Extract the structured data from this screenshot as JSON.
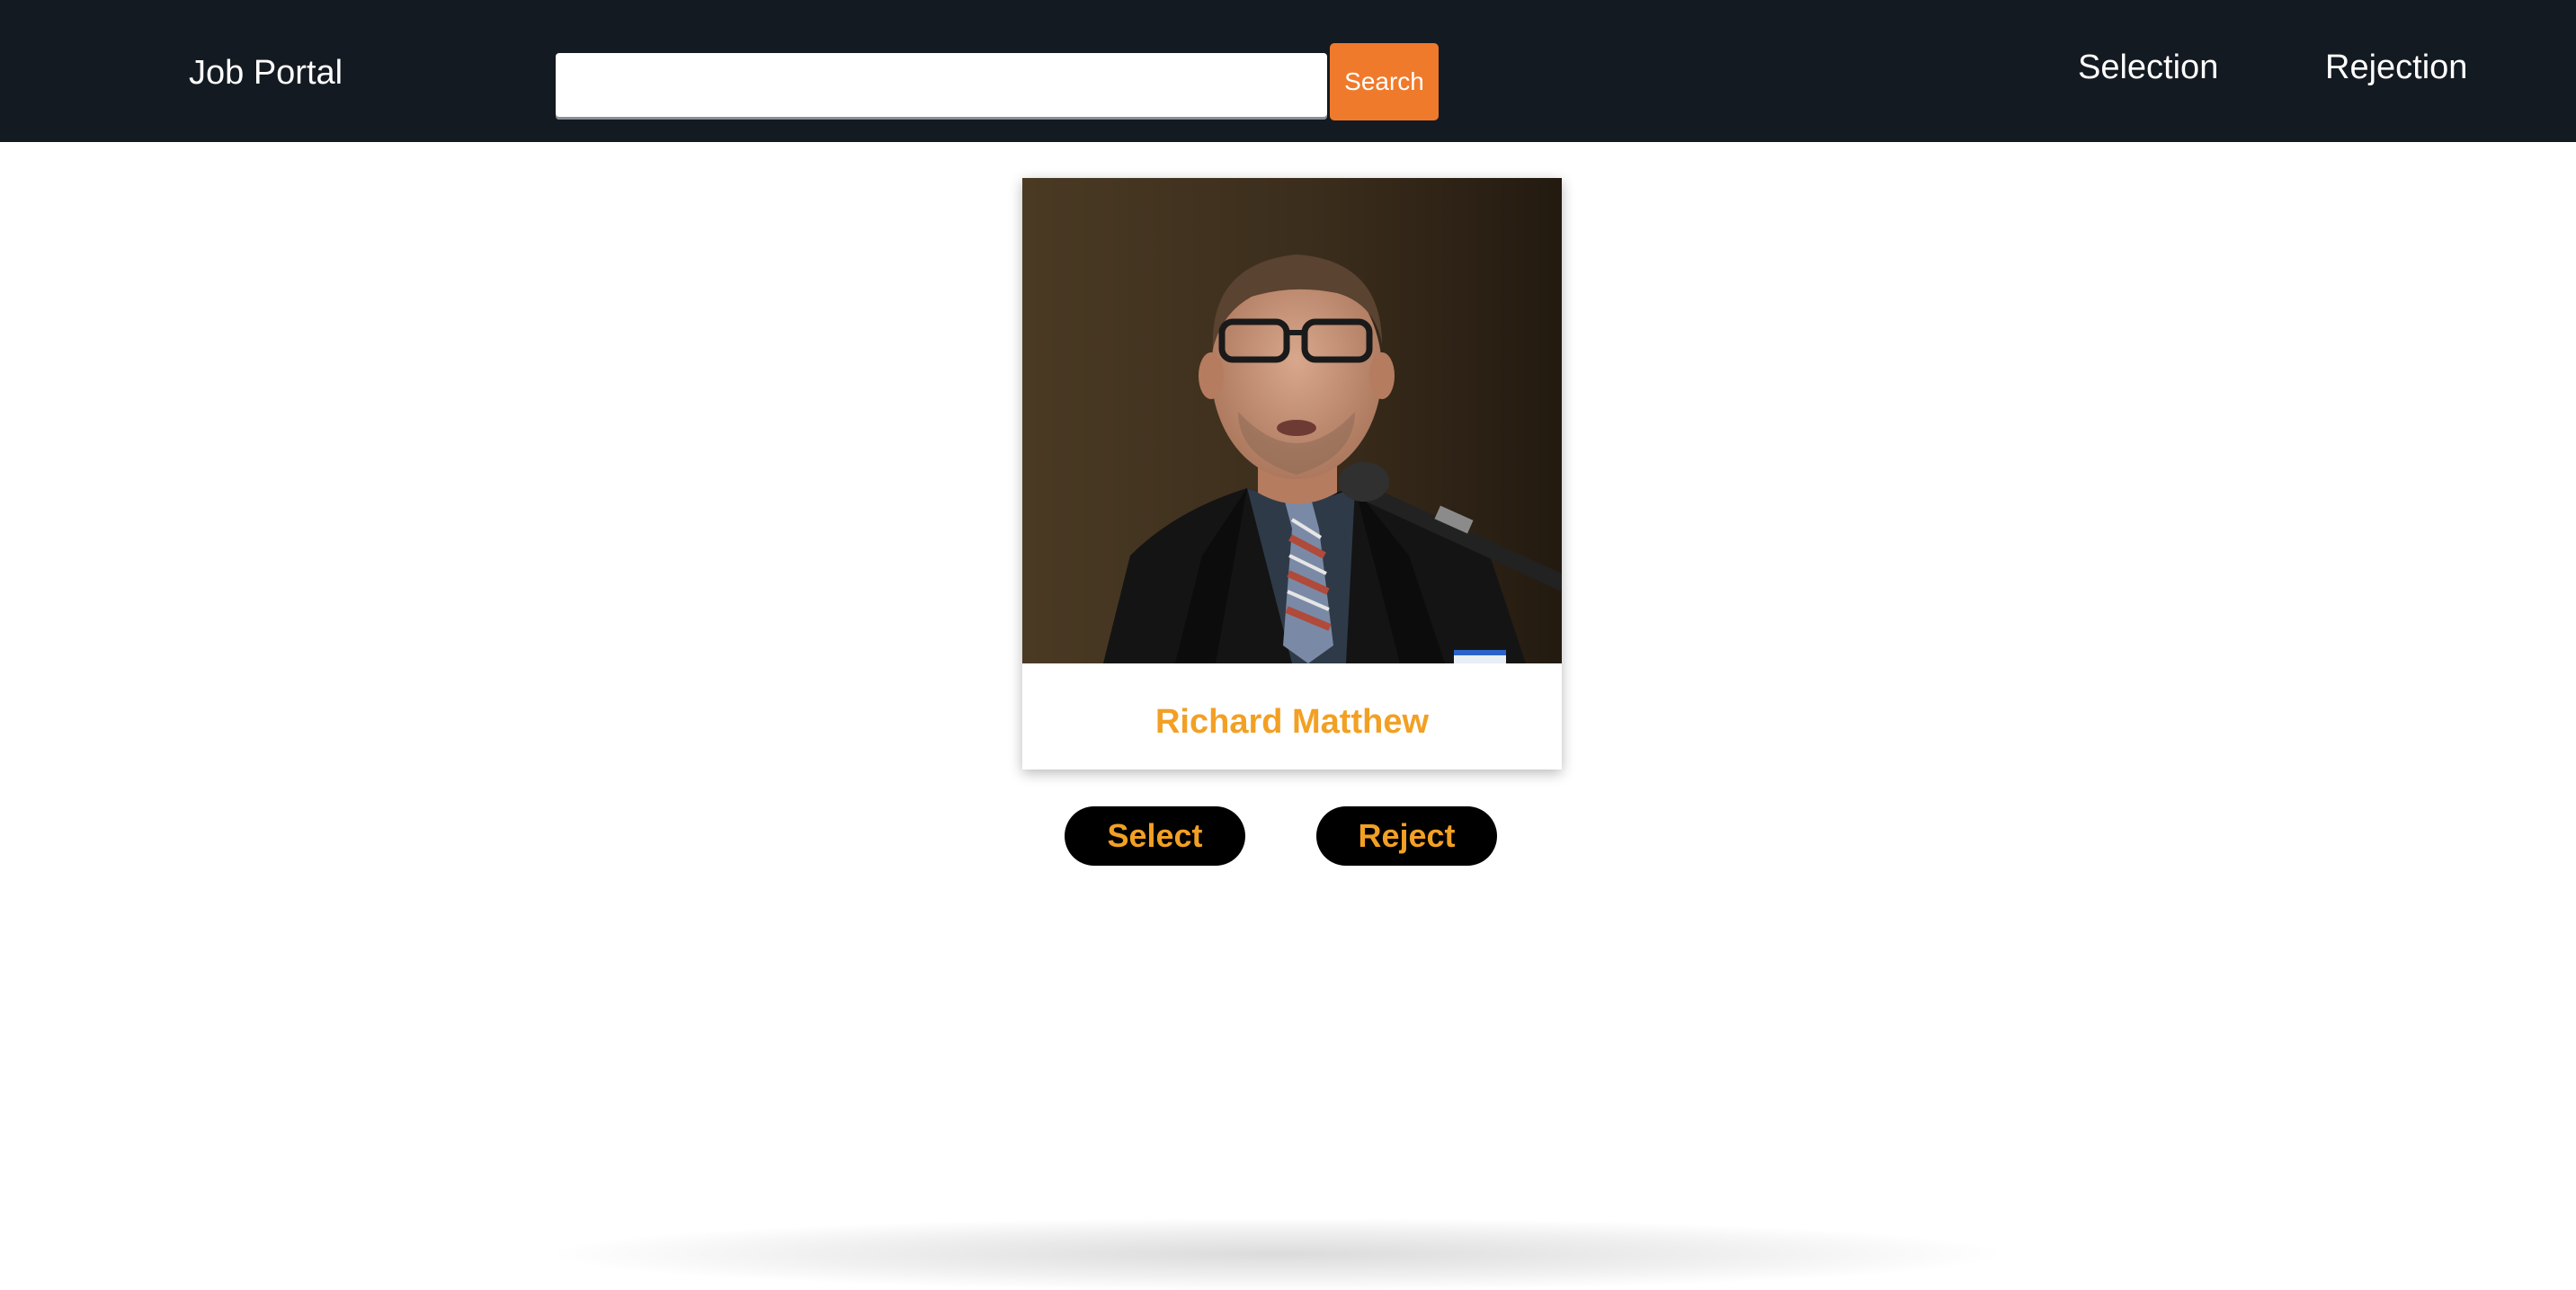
{
  "header": {
    "brand": "Job Portal",
    "search": {
      "value": "",
      "placeholder": "",
      "button_label": "Search"
    },
    "nav": {
      "selection_label": "Selection",
      "rejection_label": "Rejection"
    }
  },
  "candidate": {
    "name": "Richard Matthew",
    "photo_icon": "candidate-portrait"
  },
  "actions": {
    "select_label": "Select",
    "reject_label": "Reject"
  },
  "colors": {
    "navbar": "#141a21",
    "search_button": "#f07a2b",
    "accent_text": "#f2a024",
    "pill_background": "#000000"
  }
}
